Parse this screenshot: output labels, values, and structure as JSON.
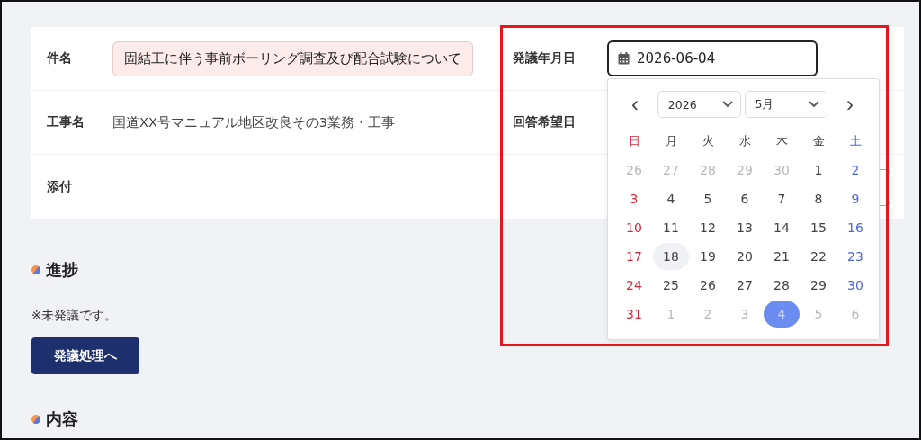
{
  "fields": [
    {
      "label": "件名",
      "value": "固結工に伴う事前ボーリング調査及び配合試験について",
      "kind": "highlighted"
    },
    {
      "label": "工事名",
      "value": "国道XX号マニュアル地区改良その3業務・工事",
      "kind": "plain"
    },
    {
      "label": "添付",
      "kind": "empty"
    }
  ],
  "date_field": {
    "label": "発議年月日",
    "value": "2026-06-04",
    "focused": true
  },
  "answer_date": {
    "label": "回答希望日"
  },
  "calendar": {
    "prev": "‹",
    "next": "›",
    "year": "2026",
    "month": "5月",
    "weekdays": [
      "日",
      "月",
      "火",
      "水",
      "木",
      "金",
      "土"
    ],
    "weeks": [
      [
        {
          "day": "26",
          "outside": true,
          "selected": false,
          "hovered": false
        },
        {
          "day": "27",
          "outside": true,
          "selected": false,
          "hovered": false
        },
        {
          "day": "28",
          "outside": true,
          "selected": false,
          "hovered": false
        },
        {
          "day": "29",
          "outside": true,
          "selected": false,
          "hovered": false
        },
        {
          "day": "30",
          "outside": true,
          "selected": false,
          "hovered": false
        },
        {
          "day": "1",
          "outside": false,
          "selected": false,
          "hovered": false
        },
        {
          "day": "2",
          "outside": false,
          "selected": false,
          "hovered": false
        }
      ],
      [
        {
          "day": "3",
          "outside": false,
          "selected": false,
          "hovered": false
        },
        {
          "day": "4",
          "outside": false,
          "selected": false,
          "hovered": false
        },
        {
          "day": "5",
          "outside": false,
          "selected": false,
          "hovered": false
        },
        {
          "day": "6",
          "outside": false,
          "selected": false,
          "hovered": false
        },
        {
          "day": "7",
          "outside": false,
          "selected": false,
          "hovered": false
        },
        {
          "day": "8",
          "outside": false,
          "selected": false,
          "hovered": false
        },
        {
          "day": "9",
          "outside": false,
          "selected": false,
          "hovered": false
        }
      ],
      [
        {
          "day": "10",
          "outside": false,
          "selected": false,
          "hovered": false
        },
        {
          "day": "11",
          "outside": false,
          "selected": false,
          "hovered": false
        },
        {
          "day": "12",
          "outside": false,
          "selected": false,
          "hovered": false
        },
        {
          "day": "13",
          "outside": false,
          "selected": false,
          "hovered": false
        },
        {
          "day": "14",
          "outside": false,
          "selected": false,
          "hovered": false
        },
        {
          "day": "15",
          "outside": false,
          "selected": false,
          "hovered": false
        },
        {
          "day": "16",
          "outside": false,
          "selected": false,
          "hovered": false
        }
      ],
      [
        {
          "day": "17",
          "outside": false,
          "selected": false,
          "hovered": false
        },
        {
          "day": "18",
          "outside": false,
          "selected": false,
          "hovered": true
        },
        {
          "day": "19",
          "outside": false,
          "selected": false,
          "hovered": false
        },
        {
          "day": "20",
          "outside": false,
          "selected": false,
          "hovered": false
        },
        {
          "day": "21",
          "outside": false,
          "selected": false,
          "hovered": false
        },
        {
          "day": "22",
          "outside": false,
          "selected": false,
          "hovered": false
        },
        {
          "day": "23",
          "outside": false,
          "selected": false,
          "hovered": false
        }
      ],
      [
        {
          "day": "24",
          "outside": false,
          "selected": false,
          "hovered": false
        },
        {
          "day": "25",
          "outside": false,
          "selected": false,
          "hovered": false
        },
        {
          "day": "26",
          "outside": false,
          "selected": false,
          "hovered": false
        },
        {
          "day": "27",
          "outside": false,
          "selected": false,
          "hovered": false
        },
        {
          "day": "28",
          "outside": false,
          "selected": false,
          "hovered": false
        },
        {
          "day": "29",
          "outside": false,
          "selected": false,
          "hovered": false
        },
        {
          "day": "30",
          "outside": false,
          "selected": false,
          "hovered": false
        }
      ],
      [
        {
          "day": "31",
          "outside": false,
          "selected": false,
          "hovered": false
        },
        {
          "day": "1",
          "outside": true,
          "selected": false,
          "hovered": false
        },
        {
          "day": "2",
          "outside": true,
          "selected": false,
          "hovered": false
        },
        {
          "day": "3",
          "outside": true,
          "selected": false,
          "hovered": false
        },
        {
          "day": "4",
          "outside": true,
          "selected": true,
          "hovered": false
        },
        {
          "day": "5",
          "outside": true,
          "selected": false,
          "hovered": false
        },
        {
          "day": "6",
          "outside": true,
          "selected": false,
          "hovered": false
        }
      ]
    ]
  },
  "progress": {
    "title": "進捗",
    "note": "※未発議です。",
    "button": "発議処理へ"
  },
  "content": {
    "title": "内容"
  }
}
